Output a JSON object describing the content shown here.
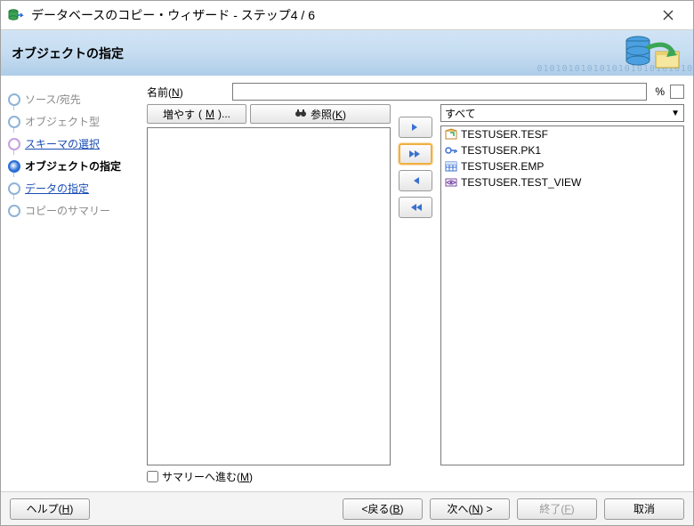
{
  "title": "データベースのコピー・ウィザード - ステップ4 / 6",
  "header": {
    "heading": "オブジェクトの指定"
  },
  "sidebar": {
    "steps": [
      {
        "label": "ソース/宛先"
      },
      {
        "label": "オブジェクト型"
      },
      {
        "label": "スキーマの選択"
      },
      {
        "label": "オブジェクトの指定"
      },
      {
        "label": "データの指定"
      },
      {
        "label": "コピーのサマリー"
      }
    ]
  },
  "main": {
    "name_label": "名前",
    "name_mnemonic": "N",
    "name_value": "",
    "pct_label": "%",
    "more_btn": "増やす",
    "more_mnemonic": "M",
    "browse_btn": "参照",
    "browse_mnemonic": "K",
    "filter_selected": "すべて",
    "objects": [
      {
        "icon": "package",
        "name": "TESTUSER.TESF"
      },
      {
        "icon": "key",
        "name": "TESTUSER.PK1"
      },
      {
        "icon": "table",
        "name": "TESTUSER.EMP"
      },
      {
        "icon": "view",
        "name": "TESTUSER.TEST_VIEW"
      }
    ],
    "summary_label": "サマリーへ進む",
    "summary_mnemonic": "M"
  },
  "footer": {
    "help": "ヘルプ",
    "help_m": "H",
    "back": "戻る",
    "back_m": "B",
    "next": "次へ",
    "next_m": "N",
    "finish": "終了",
    "finish_m": "F",
    "cancel": "取消"
  }
}
